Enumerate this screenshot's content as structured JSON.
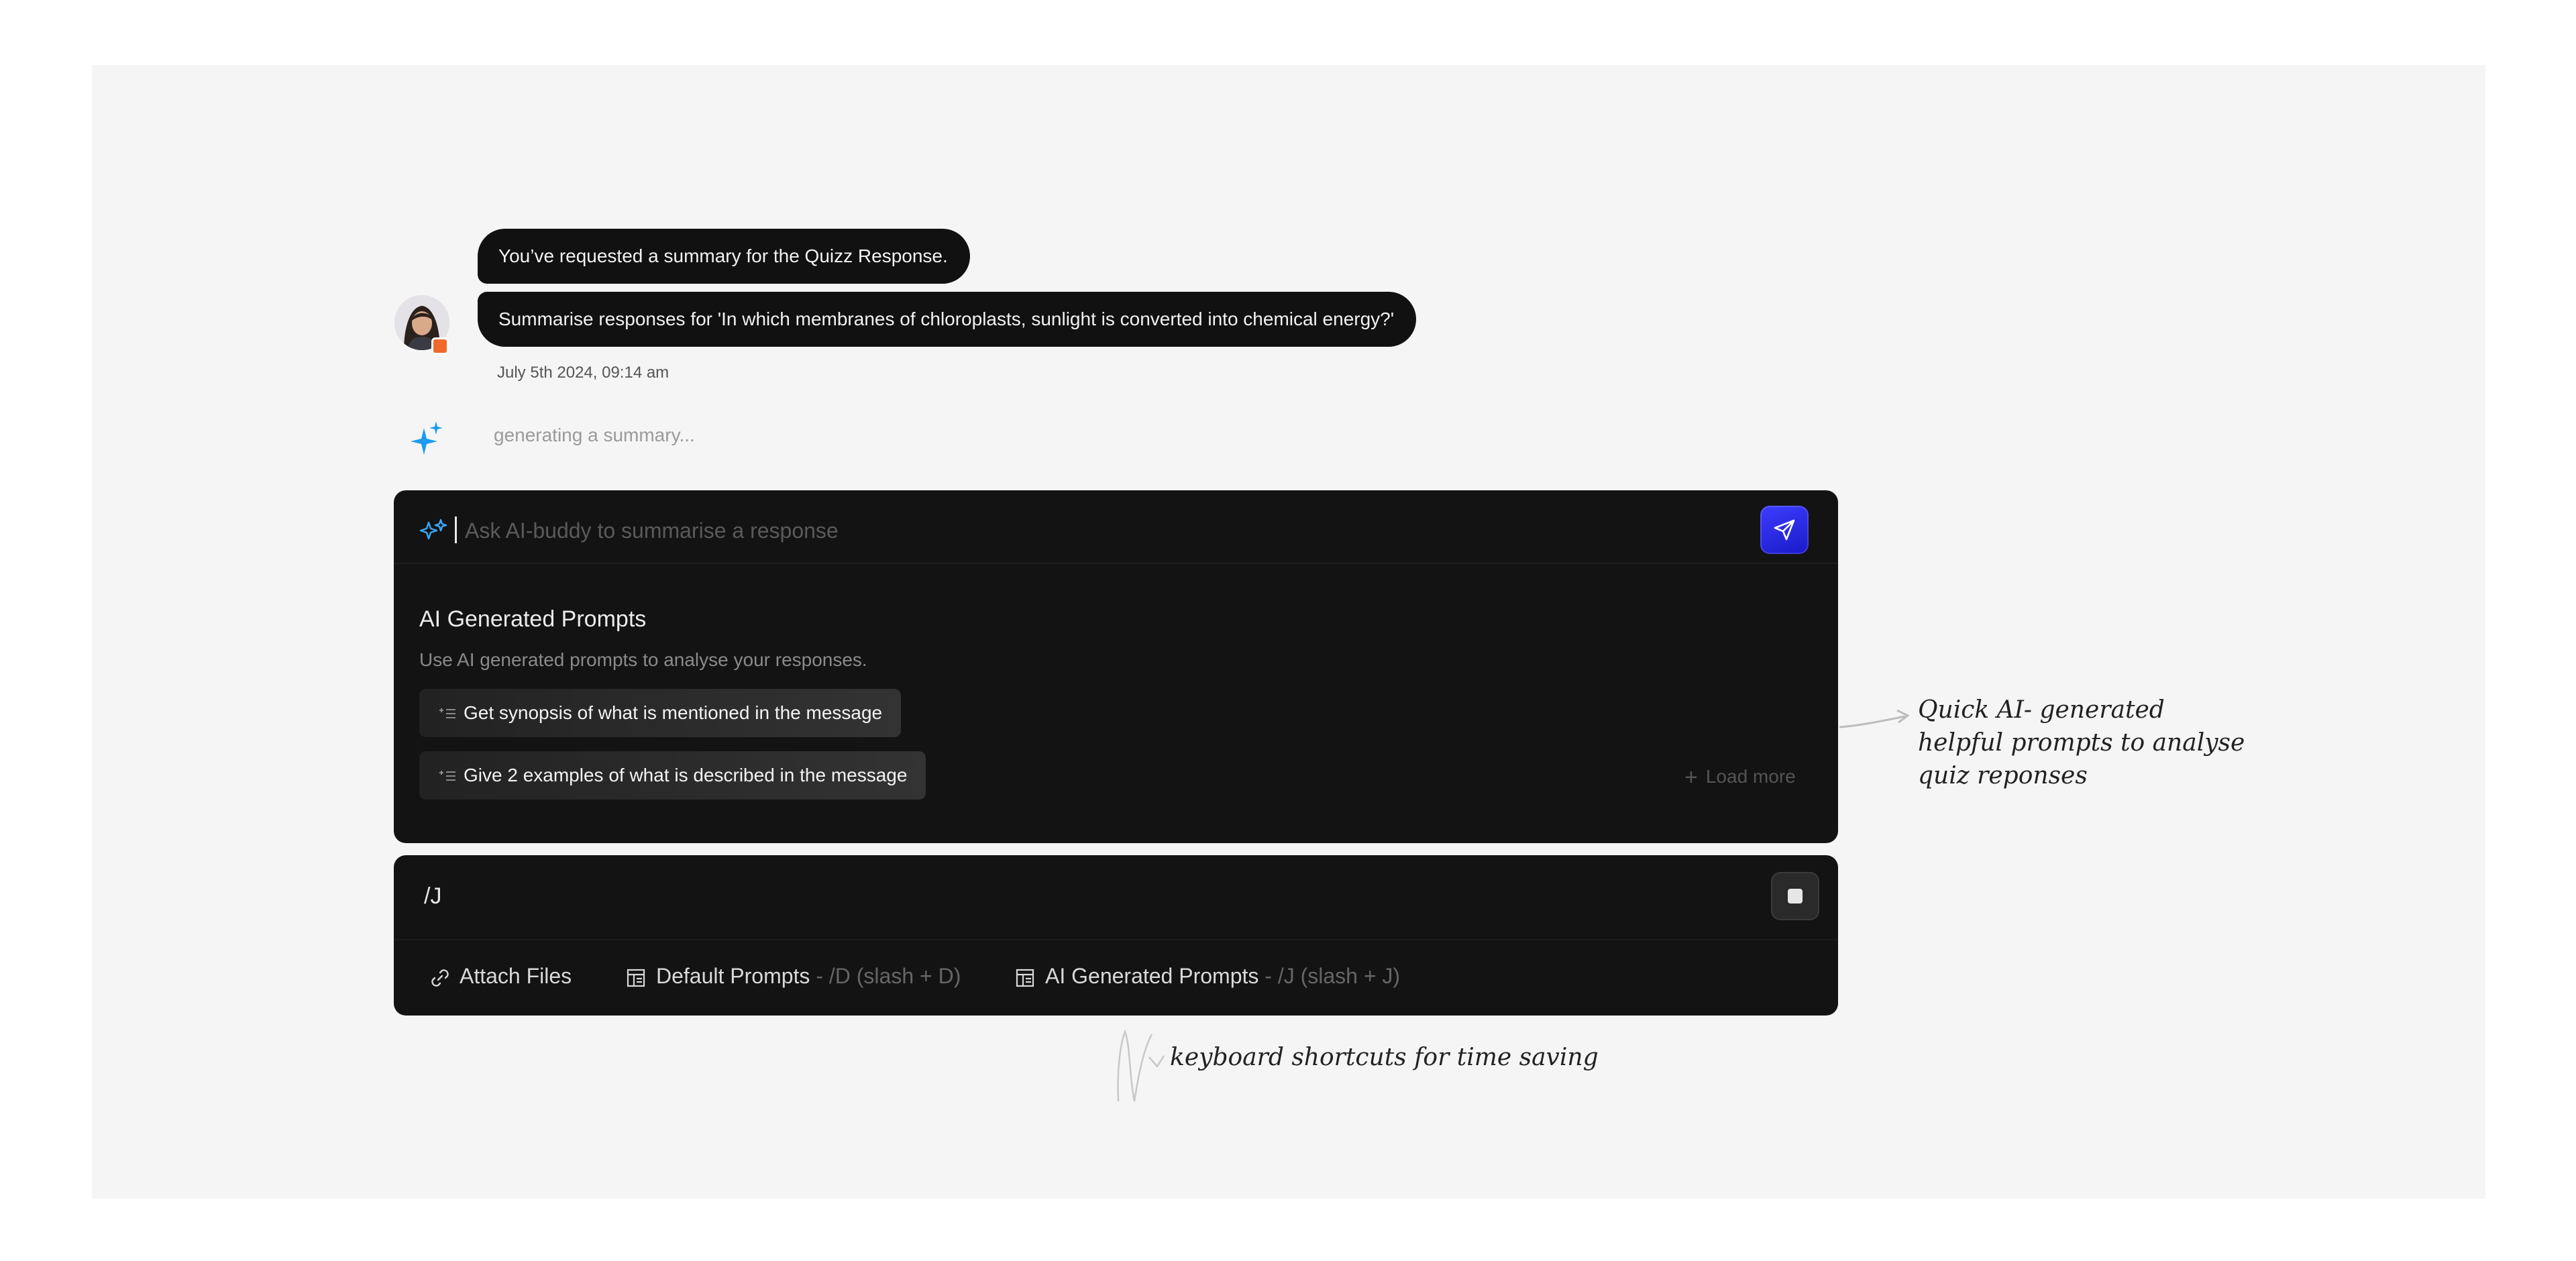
{
  "chat": {
    "messages": [
      "You’ve requested a summary for the Quizz Response.",
      "Summarise responses for 'In which membranes of chloroplasts, sunlight is converted into chemical energy?'"
    ],
    "timestamp": "July 5th 2024, 09:14 am",
    "status": "generating a summary..."
  },
  "ai_panel": {
    "placeholder": "Ask AI-buddy to summarise a response",
    "title": "AI Generated Prompts",
    "subtitle": "Use AI generated prompts to analyse your responses.",
    "prompts": [
      "Get synopsis of what is mentioned in the message",
      "Give 2 examples of what is described in the message"
    ],
    "load_more": "Load more"
  },
  "command_panel": {
    "input_value": "/J",
    "toolbar": [
      {
        "label": "Attach Files",
        "hint": ""
      },
      {
        "label": "Default Prompts",
        "hint": " - /D (slash + D)"
      },
      {
        "label": "AI Generated Prompts",
        "hint": " - /J (slash + J)"
      }
    ]
  },
  "annotations": {
    "ai_prompts_lines": [
      "Quick AI- generated",
      "helpful prompts to analyse",
      "quiz reponses"
    ],
    "shortcuts": "keyboard shortcuts for time saving"
  },
  "colors": {
    "accent": "#2b2bf0",
    "sparkle": "#1e9bf0",
    "panel": "#131313",
    "badge": "#ef6a2c"
  }
}
